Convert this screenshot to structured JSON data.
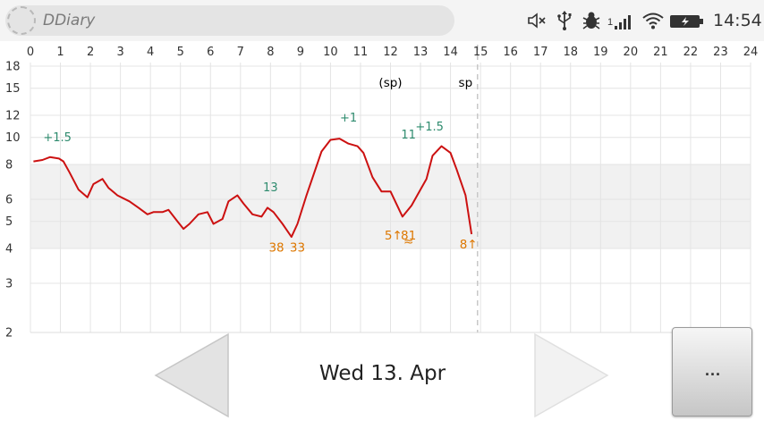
{
  "app": {
    "title": "DDiary"
  },
  "status_bar": {
    "icons": [
      "volume-mute-icon",
      "usb-icon",
      "bug-icon",
      "signal-icon",
      "wifi-icon",
      "battery-charging-icon"
    ],
    "sim_slot": "1",
    "time": "14:54"
  },
  "chart_data": {
    "type": "line",
    "x_ticks": [
      "0",
      "1",
      "2",
      "3",
      "4",
      "5",
      "6",
      "7",
      "8",
      "9",
      "10",
      "11",
      "12",
      "13",
      "14",
      "15",
      "16",
      "17",
      "18",
      "19",
      "20",
      "21",
      "22",
      "23",
      "24"
    ],
    "y_ticks": [
      "18",
      "15",
      "12",
      "10",
      "8",
      "6",
      "5",
      "4",
      "3",
      "2"
    ],
    "xlim": [
      0,
      24
    ],
    "ylim": [
      2,
      18
    ],
    "y_scale": "log",
    "target_range": [
      4,
      8
    ],
    "current_time": 14.9,
    "grid": true,
    "series": [
      {
        "color": "#cc1111",
        "points": [
          [
            0.1,
            8.2
          ],
          [
            0.4,
            8.3
          ],
          [
            0.65,
            8.5
          ],
          [
            0.95,
            8.4
          ],
          [
            1.1,
            8.2
          ],
          [
            1.3,
            7.5
          ],
          [
            1.6,
            6.5
          ],
          [
            1.9,
            6.1
          ],
          [
            2.1,
            6.8
          ],
          [
            2.4,
            7.1
          ],
          [
            2.6,
            6.6
          ],
          [
            2.9,
            6.2
          ],
          [
            3.3,
            5.9
          ],
          [
            3.6,
            5.6
          ],
          [
            3.9,
            5.3
          ],
          [
            4.1,
            5.4
          ],
          [
            4.4,
            5.4
          ],
          [
            4.6,
            5.5
          ],
          [
            4.9,
            5.0
          ],
          [
            5.1,
            4.7
          ],
          [
            5.3,
            4.9
          ],
          [
            5.6,
            5.3
          ],
          [
            5.9,
            5.4
          ],
          [
            6.1,
            4.9
          ],
          [
            6.4,
            5.1
          ],
          [
            6.6,
            5.9
          ],
          [
            6.9,
            6.2
          ],
          [
            7.1,
            5.8
          ],
          [
            7.4,
            5.3
          ],
          [
            7.7,
            5.2
          ],
          [
            7.9,
            5.6
          ],
          [
            8.1,
            5.4
          ],
          [
            8.4,
            4.9
          ],
          [
            8.7,
            4.4
          ],
          [
            8.9,
            4.9
          ],
          [
            9.2,
            6.2
          ],
          [
            9.7,
            8.9
          ],
          [
            10.0,
            9.8
          ],
          [
            10.3,
            9.9
          ],
          [
            10.6,
            9.5
          ],
          [
            10.9,
            9.3
          ],
          [
            11.1,
            8.8
          ],
          [
            11.4,
            7.2
          ],
          [
            11.7,
            6.4
          ],
          [
            12.0,
            6.4
          ],
          [
            12.4,
            5.2
          ],
          [
            12.7,
            5.7
          ],
          [
            13.0,
            6.5
          ],
          [
            13.2,
            7.1
          ],
          [
            13.4,
            8.6
          ],
          [
            13.7,
            9.3
          ],
          [
            14.0,
            8.8
          ],
          [
            14.2,
            7.7
          ],
          [
            14.5,
            6.2
          ],
          [
            14.7,
            4.5
          ]
        ]
      }
    ],
    "annotations": {
      "doses": [
        {
          "text": "+1.5",
          "x": 0.9,
          "y": 9.7
        },
        {
          "text": "13",
          "x": 8.0,
          "y": 6.4
        },
        {
          "text": "+1",
          "x": 10.6,
          "y": 11.4
        },
        {
          "text": "11",
          "x": 12.6,
          "y": 9.9
        },
        {
          "text": "+1.5",
          "x": 13.3,
          "y": 10.6
        }
      ],
      "carbs": [
        {
          "text": "38",
          "x": 8.2,
          "y": 3.9
        },
        {
          "text": "33",
          "x": 8.9,
          "y": 3.9
        },
        {
          "text": "5↑",
          "x": 12.1,
          "y": 4.3
        },
        {
          "text": "81",
          "x": 12.6,
          "y": 4.3
        },
        {
          "text": "≈",
          "x": 12.6,
          "y": 4.1
        },
        {
          "text": "8↑",
          "x": 14.6,
          "y": 4.0
        }
      ],
      "markers": [
        {
          "text": "(sp)",
          "x": 12.0,
          "y": 15.2
        },
        {
          "text": "sp",
          "x": 14.5,
          "y": 15.2
        }
      ]
    },
    "colors": {
      "line": "#cc1111",
      "insulin": "#2e8b6e",
      "carbs": "#dd7700",
      "marker": "#000000"
    }
  },
  "nav": {
    "date": "Wed 13. Apr",
    "more_label": "...",
    "prev_label": "previous day",
    "next_label": "next day"
  }
}
